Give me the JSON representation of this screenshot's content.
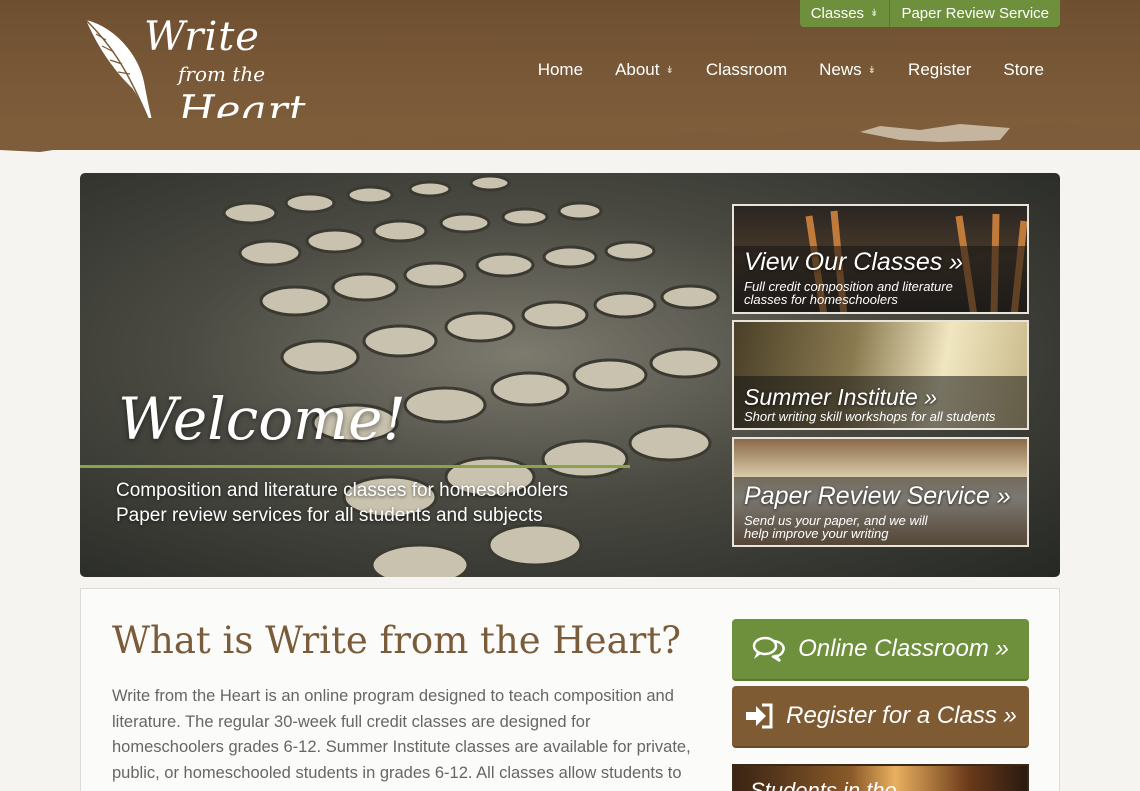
{
  "logo": {
    "line1": "Write",
    "line2": "from the",
    "line3": "Heart"
  },
  "topbar": {
    "classes": "Classes",
    "paper_review": "Paper Review Service"
  },
  "nav": {
    "home": "Home",
    "about": "About",
    "classroom": "Classroom",
    "news": "News",
    "register": "Register",
    "store": "Store"
  },
  "hero": {
    "welcome": "Welcome!",
    "sub1": "Composition and literature classes for homeschoolers",
    "sub2": "Paper review services for all students and subjects"
  },
  "promos": [
    {
      "title": "View Our Classes »",
      "desc1": "Full credit composition and literature",
      "desc2": "classes for homeschoolers"
    },
    {
      "title": "Summer Institute »",
      "desc1": "Short writing skill workshops for all students",
      "desc2": ""
    },
    {
      "title": "Paper Review Service »",
      "desc1": "Send us your paper, and we will",
      "desc2": "help improve your writing"
    }
  ],
  "content": {
    "heading": "What is Write from the Heart?",
    "body": "Write from the Heart is an online program designed to teach composition and literature. The regular 30-week full credit classes are designed for homeschoolers grades 6-12. Summer Institute classes are available for private, public, or homeschooled students in grades 6-12. All classes allow students to interact with"
  },
  "buttons": {
    "online_classroom": "Online Classroom »",
    "register_class": "Register for a Class »"
  },
  "students_banner": "Students in the",
  "colors": {
    "header_brown": "#7a5a38",
    "accent_green": "#6e8f3c",
    "button_brown": "#7f5b33",
    "heading_brown": "#7a5c3a"
  },
  "icons": [
    "quill-icon",
    "chevron-down-icon",
    "chat-bubbles-icon",
    "sign-in-icon"
  ]
}
